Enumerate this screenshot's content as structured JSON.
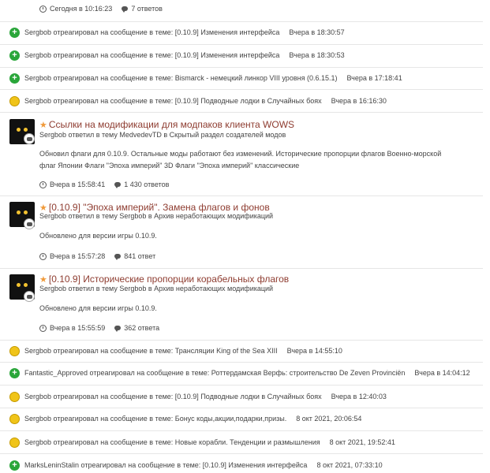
{
  "top_meta": {
    "time": "Сегодня в 10:16:23",
    "replies": "7 ответов"
  },
  "activities_a": [
    {
      "icon": "plus",
      "text": "Sergbob отреагировал на сообщение в теме: [0.10.9] Изменения интерфейса",
      "time": "Вчера в 18:30:57"
    },
    {
      "icon": "plus",
      "text": "Sergbob отреагировал на сообщение в теме: [0.10.9] Изменения интерфейса",
      "time": "Вчера в 18:30:53"
    },
    {
      "icon": "plus",
      "text": "Sergbob отреагировал на сообщение в теме: Bismarck - немецкий линкор VIII уровня (0.6.15.1)",
      "time": "Вчера в 17:18:41"
    },
    {
      "icon": "smile",
      "text": "Sergbob отреагировал на сообщение в теме: [0.10.9] Подводные лодки в Случайных боях",
      "time": "Вчера в 16:16:30"
    }
  ],
  "posts": [
    {
      "title": "Ссылки на модификации для модпаков клиента WOWS",
      "sub": "Sergbob ответил в тему MedvedevTD в Скрытый раздел создателей модов",
      "snippet": "Обновил флаги для 0.10.9. Остальные моды работают без изменений. Исторические пропорции флагов Военно-морской флаг Японии Флаги \"Эпоха империй\" 3D Флаги \"Эпоха империй\" классические",
      "time": "Вчера в 15:58:41",
      "replies": "1 430 ответов"
    },
    {
      "title": "[0.10.9] \"Эпоха империй\". Замена флагов и фонов",
      "sub": "Sergbob ответил в тему Sergbob в Архив неработающих модификаций",
      "snippet": "Обновлено для версии игры 0.10.9.",
      "time": "Вчера в 15:57:28",
      "replies": "841 ответ"
    },
    {
      "title": "[0.10.9] Исторические пропорции корабельных флагов",
      "sub": "Sergbob ответил в тему Sergbob в Архив неработающих модификаций",
      "snippet": "Обновлено для версии игры 0.10.9.",
      "time": "Вчера в 15:55:59",
      "replies": "362 ответа"
    }
  ],
  "activities_b": [
    {
      "icon": "smile",
      "text": "Sergbob отреагировал на сообщение в теме: Трансляции King of the Sea XIII",
      "time": "Вчера в 14:55:10"
    },
    {
      "icon": "plus",
      "text": "Fantastic_Approved отреагировал на сообщение в теме: Роттердамская Верфь: строительство De Zeven Provinciën",
      "time": "Вчера в 14:04:12"
    },
    {
      "icon": "smile",
      "text": "Sergbob отреагировал на сообщение в теме: [0.10.9] Подводные лодки в Случайных боях",
      "time": "Вчера в 12:40:03"
    },
    {
      "icon": "smile",
      "text": "Sergbob отреагировал на сообщение в теме: Бонус коды,акции,подарки,призы.",
      "time": "8 окт 2021, 20:06:54"
    },
    {
      "icon": "smile",
      "text": "Sergbob отреагировал на сообщение в теме: Новые корабли. Тенденции и размышления",
      "time": "8 окт 2021, 19:52:41"
    },
    {
      "icon": "plus",
      "text": "MarksLeninStalin отреагировал на сообщение в теме: [0.10.9] Изменения интерфейса",
      "time": "8 окт 2021, 07:33:10"
    }
  ]
}
